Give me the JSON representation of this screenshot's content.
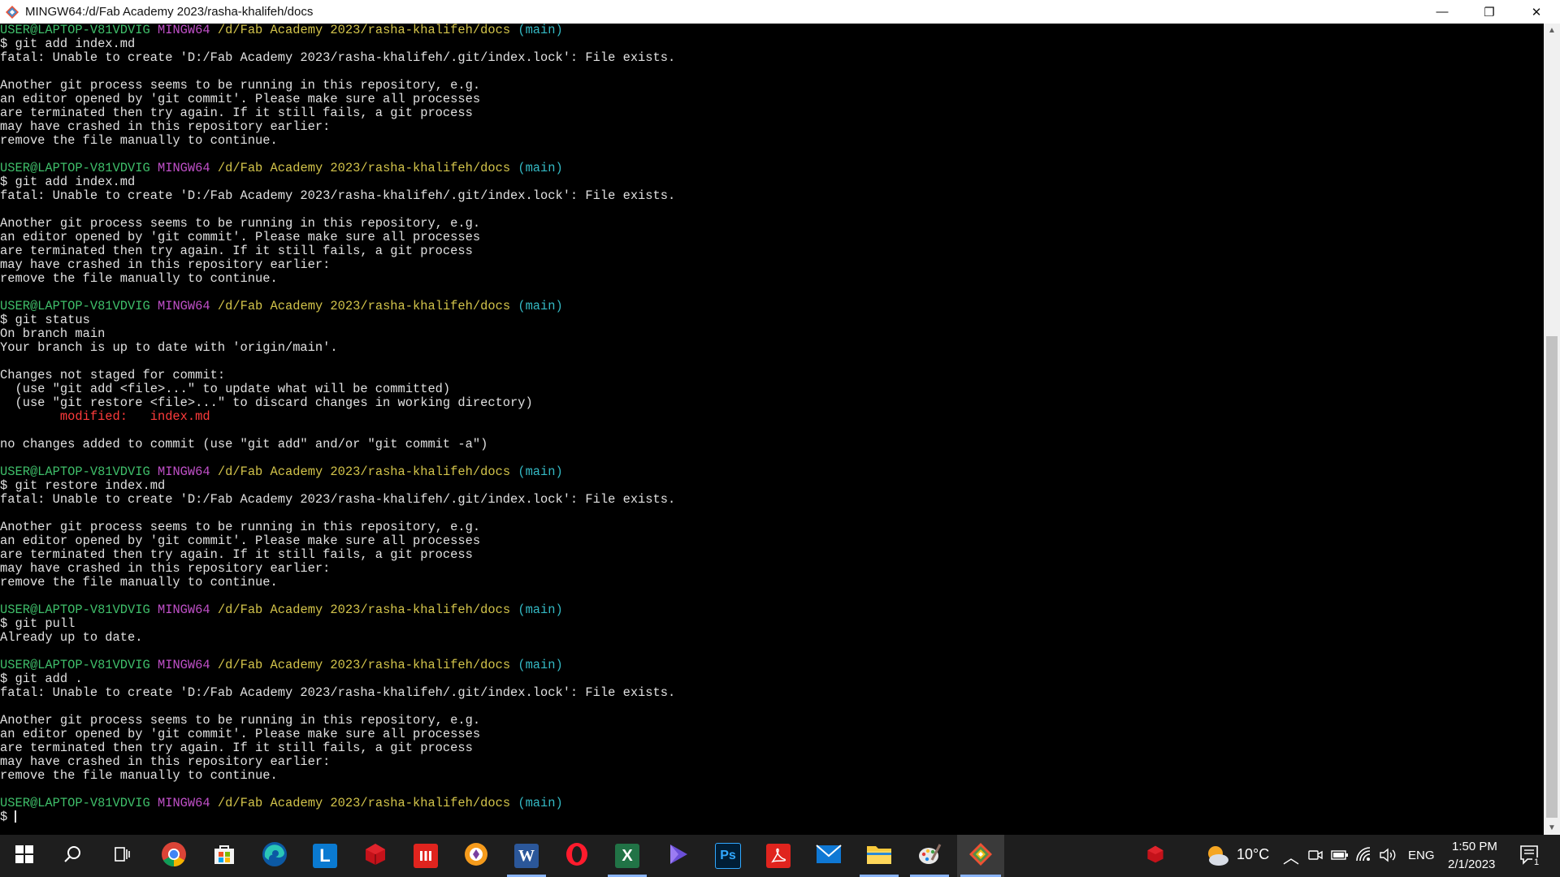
{
  "window": {
    "title": "MINGW64:/d/Fab Academy 2023/rasha-khalifeh/docs",
    "controls": {
      "minimize": "—",
      "maximize": "❐",
      "close": "✕"
    }
  },
  "prompt": {
    "user": "USER@LAPTOP-V81VDVIG",
    "system": "MINGW64",
    "path": "/d/Fab Academy 2023/rasha-khalifeh/docs",
    "branch": "(main)"
  },
  "terminal": {
    "lines": [
      {
        "t": "prompt"
      },
      {
        "t": "text",
        "text": "$ git add index.md"
      },
      {
        "t": "text",
        "text": "fatal: Unable to create 'D:/Fab Academy 2023/rasha-khalifeh/.git/index.lock': File exists."
      },
      {
        "t": "text",
        "text": ""
      },
      {
        "t": "text",
        "text": "Another git process seems to be running in this repository, e.g."
      },
      {
        "t": "text",
        "text": "an editor opened by 'git commit'. Please make sure all processes"
      },
      {
        "t": "text",
        "text": "are terminated then try again. If it still fails, a git process"
      },
      {
        "t": "text",
        "text": "may have crashed in this repository earlier:"
      },
      {
        "t": "text",
        "text": "remove the file manually to continue."
      },
      {
        "t": "text",
        "text": ""
      },
      {
        "t": "prompt"
      },
      {
        "t": "text",
        "text": "$ git add index.md"
      },
      {
        "t": "text",
        "text": "fatal: Unable to create 'D:/Fab Academy 2023/rasha-khalifeh/.git/index.lock': File exists."
      },
      {
        "t": "text",
        "text": ""
      },
      {
        "t": "text",
        "text": "Another git process seems to be running in this repository, e.g."
      },
      {
        "t": "text",
        "text": "an editor opened by 'git commit'. Please make sure all processes"
      },
      {
        "t": "text",
        "text": "are terminated then try again. If it still fails, a git process"
      },
      {
        "t": "text",
        "text": "may have crashed in this repository earlier:"
      },
      {
        "t": "text",
        "text": "remove the file manually to continue."
      },
      {
        "t": "text",
        "text": ""
      },
      {
        "t": "prompt"
      },
      {
        "t": "text",
        "text": "$ git status"
      },
      {
        "t": "text",
        "text": "On branch main"
      },
      {
        "t": "text",
        "text": "Your branch is up to date with 'origin/main'."
      },
      {
        "t": "text",
        "text": ""
      },
      {
        "t": "text",
        "text": "Changes not staged for commit:"
      },
      {
        "t": "text",
        "text": "  (use \"git add <file>...\" to update what will be committed)"
      },
      {
        "t": "text",
        "text": "  (use \"git restore <file>...\" to discard changes in working directory)"
      },
      {
        "t": "red",
        "text": "        modified:   index.md"
      },
      {
        "t": "text",
        "text": ""
      },
      {
        "t": "text",
        "text": "no changes added to commit (use \"git add\" and/or \"git commit -a\")"
      },
      {
        "t": "text",
        "text": ""
      },
      {
        "t": "prompt"
      },
      {
        "t": "text",
        "text": "$ git restore index.md"
      },
      {
        "t": "text",
        "text": "fatal: Unable to create 'D:/Fab Academy 2023/rasha-khalifeh/.git/index.lock': File exists."
      },
      {
        "t": "text",
        "text": ""
      },
      {
        "t": "text",
        "text": "Another git process seems to be running in this repository, e.g."
      },
      {
        "t": "text",
        "text": "an editor opened by 'git commit'. Please make sure all processes"
      },
      {
        "t": "text",
        "text": "are terminated then try again. If it still fails, a git process"
      },
      {
        "t": "text",
        "text": "may have crashed in this repository earlier:"
      },
      {
        "t": "text",
        "text": "remove the file manually to continue."
      },
      {
        "t": "text",
        "text": ""
      },
      {
        "t": "prompt"
      },
      {
        "t": "text",
        "text": "$ git pull"
      },
      {
        "t": "text",
        "text": "Already up to date."
      },
      {
        "t": "text",
        "text": ""
      },
      {
        "t": "prompt"
      },
      {
        "t": "text",
        "text": "$ git add ."
      },
      {
        "t": "text",
        "text": "fatal: Unable to create 'D:/Fab Academy 2023/rasha-khalifeh/.git/index.lock': File exists."
      },
      {
        "t": "text",
        "text": ""
      },
      {
        "t": "text",
        "text": "Another git process seems to be running in this repository, e.g."
      },
      {
        "t": "text",
        "text": "an editor opened by 'git commit'. Please make sure all processes"
      },
      {
        "t": "text",
        "text": "are terminated then try again. If it still fails, a git process"
      },
      {
        "t": "text",
        "text": "may have crashed in this repository earlier:"
      },
      {
        "t": "text",
        "text": "remove the file manually to continue."
      },
      {
        "t": "text",
        "text": ""
      },
      {
        "t": "prompt"
      },
      {
        "t": "cursor",
        "text": "$ "
      }
    ]
  },
  "taskbar": {
    "apps": [
      {
        "name": "start-button",
        "icon": "windows-logo-icon"
      },
      {
        "name": "search-button",
        "icon": "search-icon"
      },
      {
        "name": "task-view-button",
        "icon": "task-view-icon"
      },
      {
        "name": "taskbar-chrome",
        "icon": "chrome-icon"
      },
      {
        "name": "taskbar-store",
        "icon": "store-icon"
      },
      {
        "name": "taskbar-edge",
        "icon": "edge-icon"
      },
      {
        "name": "taskbar-l-app",
        "icon": "l-app-icon",
        "label": "L"
      },
      {
        "name": "taskbar-red-app",
        "icon": "red-cube-icon"
      },
      {
        "name": "taskbar-red-square-app",
        "icon": "red-bars-icon"
      },
      {
        "name": "taskbar-orange-app",
        "icon": "orange-circle-icon"
      },
      {
        "name": "taskbar-word",
        "icon": "word-icon",
        "label": "W"
      },
      {
        "name": "taskbar-opera",
        "icon": "opera-icon"
      },
      {
        "name": "taskbar-excel",
        "icon": "excel-icon",
        "label": "X"
      },
      {
        "name": "taskbar-purple-app",
        "icon": "purple-app-icon"
      },
      {
        "name": "taskbar-photoshop",
        "icon": "photoshop-icon",
        "label": "Ps"
      },
      {
        "name": "taskbar-acrobat",
        "icon": "acrobat-icon"
      },
      {
        "name": "taskbar-mail",
        "icon": "mail-icon"
      },
      {
        "name": "taskbar-file-explorer",
        "icon": "folder-icon"
      },
      {
        "name": "taskbar-paint",
        "icon": "paint-icon"
      },
      {
        "name": "taskbar-git-bash",
        "icon": "git-icon",
        "active": true
      }
    ],
    "tray": {
      "weather_temp": "10°C",
      "language": "ENG",
      "time": "1:50 PM",
      "date": "2/1/2023",
      "notification_count": "1"
    }
  },
  "colors": {
    "prompt_user": "#3fbf6a",
    "prompt_system": "#c050c8",
    "prompt_path": "#d2c34a",
    "prompt_branch": "#34b9c4",
    "modified": "#ff3b3b",
    "taskbar_bg": "#1e1e1e"
  }
}
